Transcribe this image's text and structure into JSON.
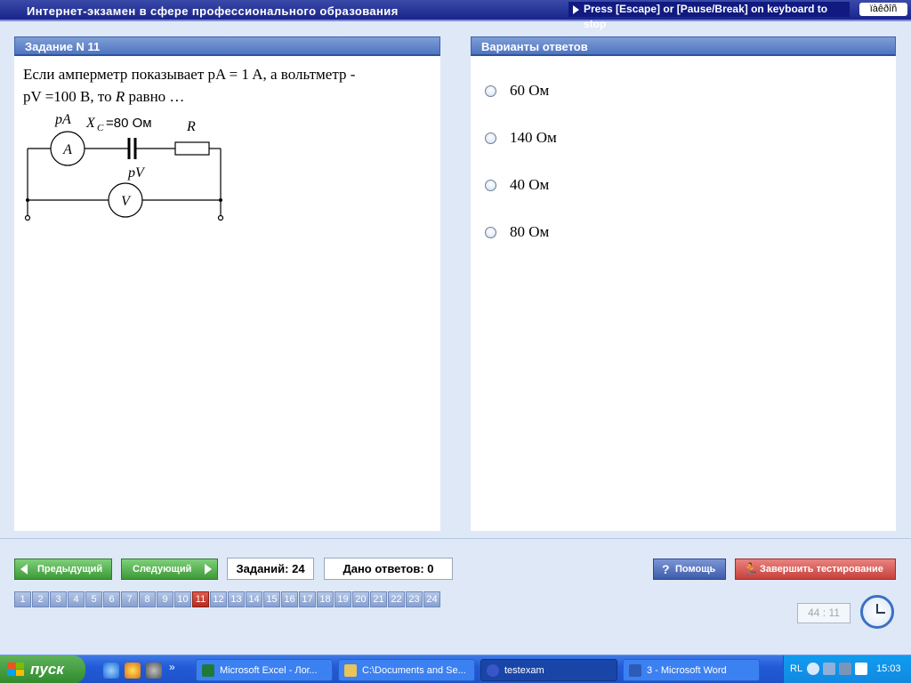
{
  "app": {
    "title": "Интернет-экзамен в сфере профессионального образования",
    "escape_hint": "Press [Escape] or [Pause/Break] on keyboard to stop",
    "lang_indicator": "ïàêðîñ"
  },
  "task": {
    "header": "Задание N 11",
    "question_line1": "Если амперметр показывает pA = 1 A, а вольтметр -",
    "question_line2_pre": "pV =100 В, то ",
    "question_line2_var": "R",
    "question_line2_post": " равно …",
    "circuit": {
      "ammeter_label": "pA",
      "ammeter_symbol": "A",
      "capacitor_label_var": "X",
      "capacitor_label_sub": "C",
      "capacitor_label_value": "=80 Ом",
      "resistor_label": "R",
      "voltmeter_label": "pV",
      "voltmeter_symbol": "V"
    }
  },
  "answers": {
    "header": "Варианты ответов",
    "options": [
      "60 Ом",
      "140 Ом",
      "40 Ом",
      "80 Ом"
    ]
  },
  "controls": {
    "prev_label": "Предыдущий",
    "next_label": "Следующий",
    "tasks_count": "Заданий: 24",
    "answers_given": "Дано ответов: 0",
    "help_label": "Помощь",
    "finish_label": "Завершить тестирование",
    "question_numbers": [
      "1",
      "2",
      "3",
      "4",
      "5",
      "6",
      "7",
      "8",
      "9",
      "10",
      "11",
      "12",
      "13",
      "14",
      "15",
      "16",
      "17",
      "18",
      "19",
      "20",
      "21",
      "22",
      "23",
      "24"
    ],
    "active_question": "11",
    "timer": "44 : 11"
  },
  "taskbar": {
    "start_label": "пуск",
    "items": [
      {
        "label": "Microsoft Excel - Лог...",
        "icon": "excel-icon",
        "color": "#1f7a3a"
      },
      {
        "label": "C:\\Documents and Se...",
        "icon": "folder-icon",
        "color": "#e8c45a"
      },
      {
        "label": "testexam",
        "icon": "app-icon",
        "color": "#3955c8"
      },
      {
        "label": "3 - Microsoft Word",
        "icon": "word-icon",
        "color": "#2c5bb8"
      }
    ],
    "active_item": "testexam",
    "tray_lang": "RL",
    "tray_time": "15:03"
  }
}
